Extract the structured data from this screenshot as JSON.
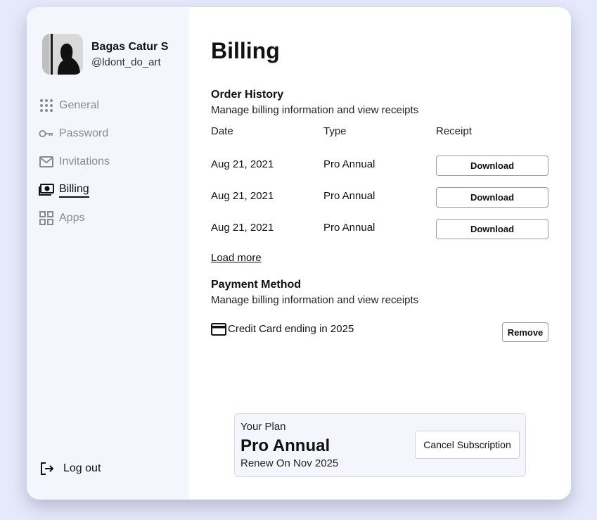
{
  "profile": {
    "name": "Bagas Catur S",
    "handle": "@ldont_do_art"
  },
  "nav": {
    "items": [
      {
        "label": "General",
        "icon": "grid-dots-icon"
      },
      {
        "label": "Password",
        "icon": "key-icon"
      },
      {
        "label": "Invitations",
        "icon": "mail-icon"
      },
      {
        "label": "Billing",
        "icon": "money-icon",
        "active": true
      },
      {
        "label": "Apps",
        "icon": "apps-icon"
      }
    ],
    "logout": "Log out"
  },
  "main": {
    "title": "Billing",
    "order_history": {
      "title": "Order History",
      "subtitle": "Manage billing information and view receipts",
      "columns": [
        "Date",
        "Type",
        "Receipt"
      ],
      "rows": [
        {
          "date": "Aug 21, 2021",
          "type": "Pro Annual",
          "receipt": "Download"
        },
        {
          "date": "Aug 21, 2021",
          "type": "Pro Annual",
          "receipt": "Download"
        },
        {
          "date": "Aug 21, 2021",
          "type": "Pro Annual",
          "receipt": "Download"
        }
      ],
      "load_more": "Load more"
    },
    "payment": {
      "title": "Payment Method",
      "subtitle": "Manage billing information and view receipts",
      "card_text": "Credit Card ending in 2025",
      "remove": "Remove"
    },
    "plan": {
      "kicker": "Your Plan",
      "name": "Pro Annual",
      "renew": "Renew On Nov 2025",
      "cancel": "Cancel Subscription"
    }
  },
  "colors": {
    "page_bg": "#e6e8fb",
    "sidebar_bg": "#f4f5fd",
    "muted": "#8a8a93",
    "text": "#111111"
  }
}
